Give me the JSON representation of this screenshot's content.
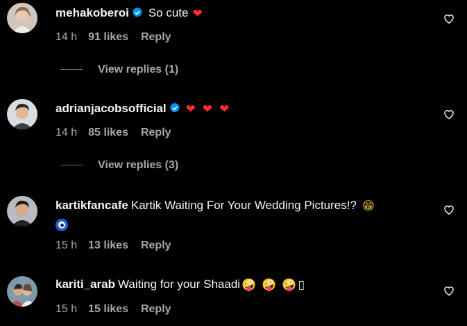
{
  "comments": [
    {
      "username": "mehakoberoi",
      "verified": true,
      "text": "So cute",
      "emojis": [
        "❤"
      ],
      "time": "14 h",
      "likes": "91 likes",
      "reply_label": "Reply",
      "view_replies": "View replies (1)"
    },
    {
      "username": "adrianjacobsofficial",
      "verified": true,
      "text": "",
      "emojis": [
        "❤",
        "❤",
        "❤"
      ],
      "time": "14 h",
      "likes": "85 likes",
      "reply_label": "Reply",
      "view_replies": "View replies (3)"
    },
    {
      "username": "kartikfancafe",
      "verified": false,
      "text": "Kartik Waiting For Your Wedding Pictures!?",
      "emojis": [
        "😁",
        "🧿"
      ],
      "time": "15 h",
      "likes": "13 likes",
      "reply_label": "Reply"
    },
    {
      "username": "kariti_arab",
      "verified": false,
      "text": "Waiting for your Shaadi",
      "emojis": [
        "🤪",
        "🤪",
        "🤪",
        "▯"
      ],
      "time": "15 h",
      "likes": "15 likes",
      "reply_label": "Reply"
    }
  ],
  "colors": {
    "background": "#000000",
    "text": "#f5f5f5",
    "muted": "#a8a8a8",
    "verified": "#0095f6",
    "heart": "#ff2d2d"
  },
  "icons": {
    "like": "heart-outline-icon",
    "verified": "verified-badge-icon"
  }
}
